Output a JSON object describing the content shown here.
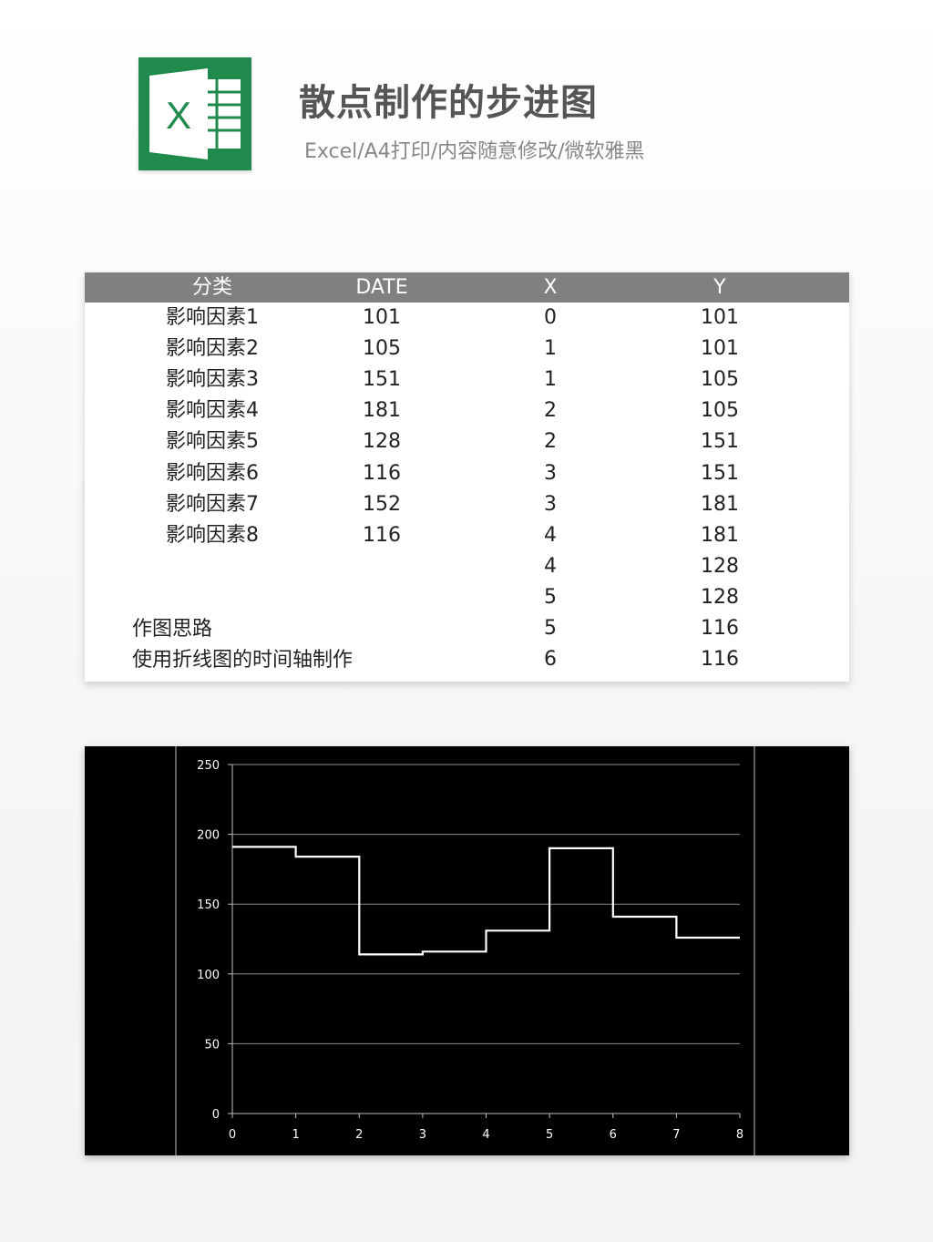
{
  "header": {
    "title": "散点制作的步进图",
    "subtitle": "Excel/A4打印/内容随意修改/微软雅黑",
    "logo_letter": "X",
    "logo_color": "#1f8a4c"
  },
  "table": {
    "headers": [
      "分类",
      "DATE",
      "X",
      "Y"
    ],
    "categories": [
      "影响因素1",
      "影响因素2",
      "影响因素3",
      "影响因素4",
      "影响因素5",
      "影响因素6",
      "影响因素7",
      "影响因素8"
    ],
    "dates": [
      "101",
      "105",
      "151",
      "181",
      "128",
      "116",
      "152",
      "116"
    ],
    "x": [
      "0",
      "1",
      "1",
      "2",
      "2",
      "3",
      "3",
      "4",
      "4",
      "5",
      "5",
      "6"
    ],
    "y": [
      "101",
      "101",
      "105",
      "105",
      "151",
      "151",
      "181",
      "181",
      "128",
      "128",
      "116",
      "116"
    ],
    "notes": [
      "作图思路",
      "使用折线图的时间轴制作"
    ]
  },
  "chart_data": {
    "type": "line",
    "step": true,
    "x": [
      0,
      1,
      1,
      2,
      2,
      3,
      3,
      4,
      4,
      5,
      5,
      6,
      6,
      7,
      7,
      8
    ],
    "y": [
      191,
      191,
      184,
      184,
      114,
      114,
      116,
      116,
      131,
      131,
      190,
      190,
      141,
      141,
      126,
      126
    ],
    "xlim": [
      0,
      8
    ],
    "ylim": [
      0,
      250
    ],
    "xticks": [
      "0",
      "1",
      "2",
      "3",
      "4",
      "5",
      "6",
      "7",
      "8"
    ],
    "yticks": [
      "0",
      "50",
      "100",
      "150",
      "200",
      "250"
    ],
    "grid": true,
    "background": "#000000",
    "line_color": "#ffffff"
  }
}
